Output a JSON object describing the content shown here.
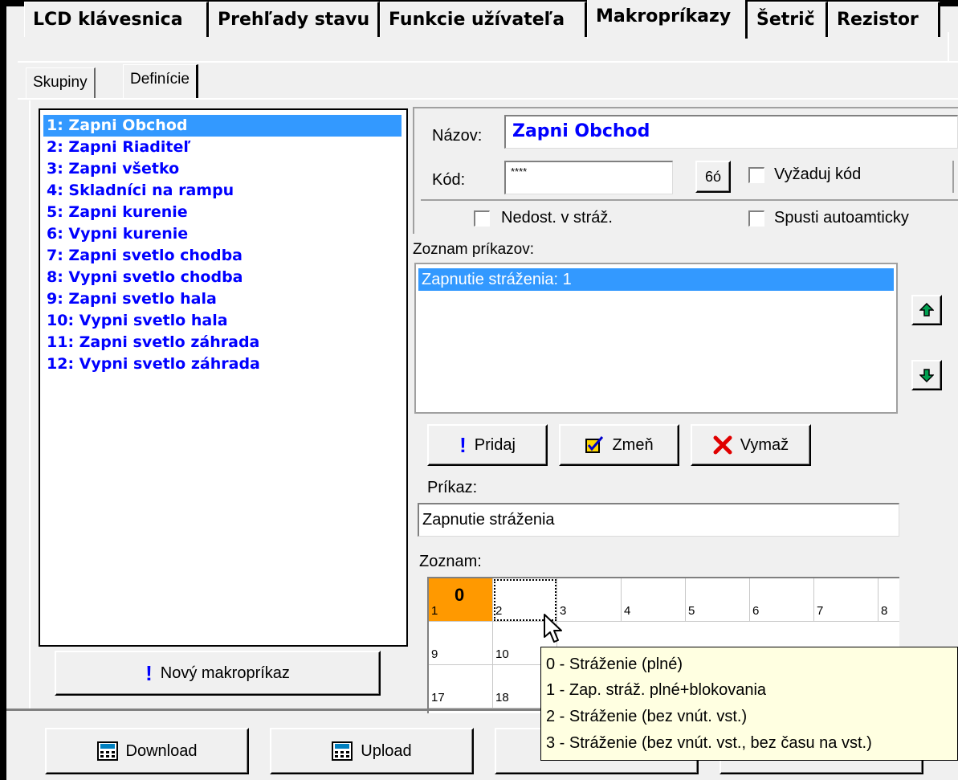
{
  "main_tabs": [
    {
      "label": "LCD klávesnica",
      "active": false
    },
    {
      "label": "Prehľady stavu",
      "active": false
    },
    {
      "label": "Funkcie užívateľa",
      "active": false
    },
    {
      "label": "Makropríkazy",
      "active": true
    },
    {
      "label": "Šetrič",
      "active": false
    },
    {
      "label": "Rezistor",
      "active": false
    }
  ],
  "sub_tabs": [
    {
      "label": "Skupiny",
      "active": false
    },
    {
      "label": "Definície",
      "active": true
    }
  ],
  "macros": [
    "1: Zapni Obchod",
    "2: Zapni Riaditeľ",
    "3: Zapni všetko",
    "4: Skladníci na rampu",
    "5: Zapni kurenie",
    "6: Vypni kurenie",
    "7: Zapni svetlo chodba",
    "8: Vypni svetlo chodba",
    "9: Zapni svetlo hala",
    "10: Vypni svetlo hala",
    "11: Zapni svetlo záhrada",
    "12: Vypni svetlo záhrada"
  ],
  "selected_macro_index": 0,
  "new_macro_button": "Nový makropríkaz",
  "details": {
    "name_label": "Názov:",
    "name_value": "Zapni Obchod",
    "code_label": "Kód:",
    "code_value": "****",
    "code_toggle_label": "6ó",
    "require_code_label": "Vyžaduj kód",
    "require_code_checked": false,
    "unavailable_armed_label": "Nedost. v stráž.",
    "unavailable_armed_checked": false,
    "auto_run_label": "Spusti autoamticky",
    "auto_run_checked": false
  },
  "commands_label": "Zoznam príkazov:",
  "commands": [
    "Zapnutie stráženia: 1"
  ],
  "actions": {
    "add": "Pridaj",
    "edit": "Zmeň",
    "delete": "Vymaž"
  },
  "command_label": "Príkaz:",
  "command_value": "Zapnutie stráženia",
  "list_label": "Zoznam:",
  "grid": {
    "selected_cell": {
      "number": "1",
      "value": "0"
    },
    "row1": [
      "2",
      "3",
      "4",
      "5",
      "6",
      "7",
      "8"
    ],
    "row2": [
      "9",
      "10"
    ],
    "row3": [
      "17",
      "18"
    ]
  },
  "tooltip_lines": [
    "0 - Stráženie (plné)",
    "1 - Zap. stráž. plné+blokovania",
    "2 - Stráženie (bez vnút. vst.)",
    "3 - Stráženie (bez vnút. vst., bez času na vst.)"
  ],
  "bottom_buttons": {
    "download": "Download",
    "upload": "Upload"
  },
  "colors": {
    "selection": "#3399ff",
    "macro_text": "#0000ff",
    "selected_cell": "#ff9900",
    "tooltip_bg": "#ffffe1"
  }
}
